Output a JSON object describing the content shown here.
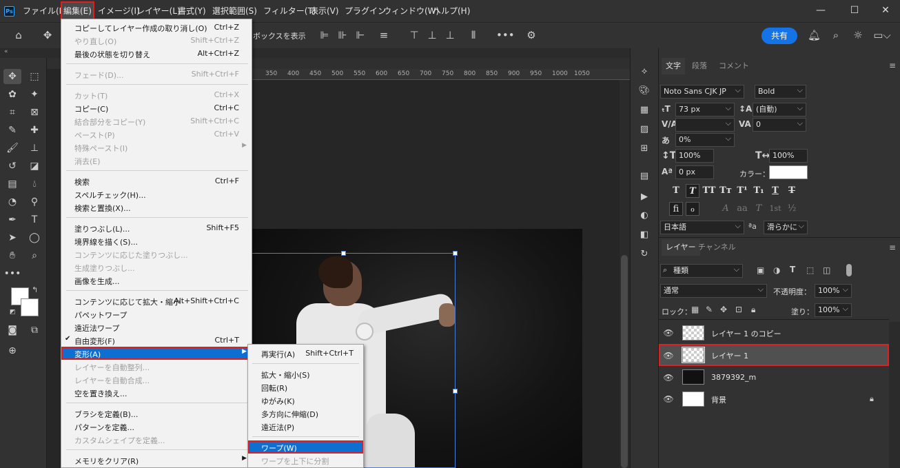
{
  "app": {
    "logo": "Ps"
  },
  "menubar": [
    "ファイル(F)",
    "編集(E)",
    "イメージ(I)",
    "レイヤー(L)",
    "書式(Y)",
    "選択範囲(S)",
    "フィルター(T)",
    "表示(V)",
    "プラグイン",
    "ウィンドウ(W)",
    "ヘルプ(H)"
  ],
  "window_controls": {
    "minimize": "—",
    "maximize": "☐",
    "close": "✕"
  },
  "options": {
    "show_box": "ボックスを表示",
    "share": "共有"
  },
  "ruler": [
    "350",
    "400",
    "450",
    "500",
    "550",
    "600",
    "650",
    "700",
    "750",
    "800",
    "850",
    "900",
    "950",
    "1000",
    "1050"
  ],
  "edit_menu": [
    {
      "label": "コピーしてレイヤー作成の取り消し(O)",
      "shortcut": "Ctrl+Z",
      "state": "normal"
    },
    {
      "label": "やり直し(O)",
      "shortcut": "Shift+Ctrl+Z",
      "state": "disabled"
    },
    {
      "label": "最後の状態を切り替え",
      "shortcut": "Alt+Ctrl+Z",
      "state": "normal"
    },
    {
      "label": "フェード(D)...",
      "shortcut": "Shift+Ctrl+F",
      "state": "disabled"
    },
    {
      "label": "カット(T)",
      "shortcut": "Ctrl+X",
      "state": "disabled"
    },
    {
      "label": "コピー(C)",
      "shortcut": "Ctrl+C",
      "state": "normal"
    },
    {
      "label": "結合部分をコピー(Y)",
      "shortcut": "Shift+Ctrl+C",
      "state": "disabled"
    },
    {
      "label": "ペースト(P)",
      "shortcut": "Ctrl+V",
      "state": "disabled"
    },
    {
      "label": "特殊ペースト(I)",
      "shortcut": "",
      "state": "disabled"
    },
    {
      "label": "消去(E)",
      "shortcut": "",
      "state": "disabled"
    },
    {
      "label": "検索",
      "shortcut": "Ctrl+F",
      "state": "normal"
    },
    {
      "label": "スペルチェック(H)...",
      "shortcut": "",
      "state": "normal"
    },
    {
      "label": "検索と置換(X)...",
      "shortcut": "",
      "state": "normal"
    },
    {
      "label": "塗りつぶし(L)...",
      "shortcut": "Shift+F5",
      "state": "normal"
    },
    {
      "label": "境界線を描く(S)...",
      "shortcut": "",
      "state": "normal"
    },
    {
      "label": "コンテンツに応じた塗りつぶし...",
      "shortcut": "",
      "state": "disabled"
    },
    {
      "label": "生成塗りつぶし...",
      "shortcut": "",
      "state": "disabled"
    },
    {
      "label": "画像を生成...",
      "shortcut": "",
      "state": "normal"
    },
    {
      "label": "コンテンツに応じて拡大・縮小",
      "shortcut": "Alt+Shift+Ctrl+C",
      "state": "normal"
    },
    {
      "label": "パペットワープ",
      "shortcut": "",
      "state": "normal"
    },
    {
      "label": "遠近法ワープ",
      "shortcut": "",
      "state": "normal"
    },
    {
      "label": "自由変形(F)",
      "shortcut": "Ctrl+T",
      "state": "normal"
    },
    {
      "label": "変形(A)",
      "shortcut": "",
      "state": "highlight"
    },
    {
      "label": "レイヤーを自動整列...",
      "shortcut": "",
      "state": "disabled"
    },
    {
      "label": "レイヤーを自動合成...",
      "shortcut": "",
      "state": "disabled"
    },
    {
      "label": "空を置き換え...",
      "shortcut": "",
      "state": "normal"
    },
    {
      "label": "ブラシを定義(B)...",
      "shortcut": "",
      "state": "normal"
    },
    {
      "label": "パターンを定義...",
      "shortcut": "",
      "state": "normal"
    },
    {
      "label": "カスタムシェイプを定義...",
      "shortcut": "",
      "state": "disabled"
    },
    {
      "label": "メモリをクリア(R)",
      "shortcut": "",
      "state": "normal"
    }
  ],
  "transform_submenu": [
    {
      "label": "再実行(A)",
      "shortcut": "Shift+Ctrl+T",
      "state": "normal"
    },
    {
      "label": "拡大・縮小(S)",
      "shortcut": "",
      "state": "normal"
    },
    {
      "label": "回転(R)",
      "shortcut": "",
      "state": "normal"
    },
    {
      "label": "ゆがみ(K)",
      "shortcut": "",
      "state": "normal"
    },
    {
      "label": "多方向に伸縮(D)",
      "shortcut": "",
      "state": "normal"
    },
    {
      "label": "遠近法(P)",
      "shortcut": "",
      "state": "normal"
    },
    {
      "label": "ワープ(W)",
      "shortcut": "",
      "state": "highlight"
    },
    {
      "label": "ワープを上下に分割",
      "shortcut": "",
      "state": "disabled"
    }
  ],
  "char_panel": {
    "tabs": [
      "文字",
      "段落",
      "コメント"
    ],
    "font_family": "Noto Sans CJK JP",
    "font_style": "Bold",
    "font_size": "73 px",
    "leading": "(自動)",
    "kerning": "",
    "tracking": "0",
    "tsume": "0%",
    "vscale": "100%",
    "hscale": "100%",
    "baseline": "0 px",
    "color_label": "カラー：",
    "color_value": "#ffffff",
    "language": "日本語",
    "aa_label": "ªa",
    "antialias": "滑らかに",
    "style_buttons_1": [
      "T",
      "T",
      "TT",
      "Tт",
      "T¹",
      "T₁",
      "T",
      "T"
    ],
    "style_buttons_2": [
      "fi",
      "ℴ",
      "A",
      "aa",
      "T",
      "1st",
      "½"
    ]
  },
  "layers_panel": {
    "tabs": [
      "レイヤー",
      "チャンネル"
    ],
    "filter": "種類",
    "blend_mode": "通常",
    "opacity_label": "不透明度：",
    "opacity": "100%",
    "lock_label": "ロック：",
    "fill_label": "塗り：",
    "fill": "100%",
    "layers": [
      {
        "name": "レイヤー 1 のコピー",
        "selected": false
      },
      {
        "name": "レイヤー 1",
        "selected": true
      },
      {
        "name": "3879392_m",
        "selected": false
      },
      {
        "name": "背景",
        "selected": false
      }
    ]
  }
}
